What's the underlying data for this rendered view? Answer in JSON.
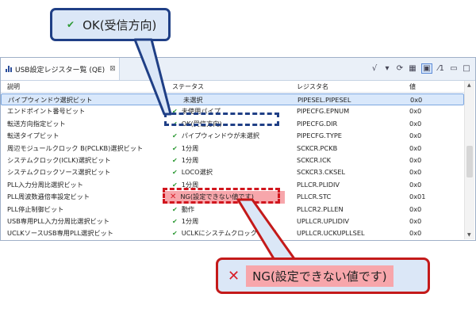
{
  "callouts": {
    "top": {
      "mark": "✔",
      "text": "OK(受信方向)"
    },
    "bottom": {
      "mark": "✕",
      "text": "NG(設定できない値です)"
    }
  },
  "view": {
    "tab_title": "USB設定レジスター覧 (QE)",
    "tab_close": "⊠",
    "toolbar": [
      "√",
      "▾",
      "⟳",
      "▦",
      "▣",
      "⁄1",
      "▭",
      "□"
    ]
  },
  "table": {
    "headers": {
      "desc": "説明",
      "status": "ステータス",
      "reg": "レジスタ名",
      "val": "値"
    },
    "rows": [
      {
        "desc": "パイプウィンドウ選択ビット",
        "mark": "",
        "status": "未選択",
        "reg": "PIPESEL.PIPESEL",
        "val": "0x0",
        "selected": true
      },
      {
        "desc": "エンドポイント番号ビット",
        "mark": "ok",
        "status": "未使用パイプ",
        "reg": "PIPECFG.EPNUM",
        "val": "0x0"
      },
      {
        "desc": "転送方向指定ビット",
        "mark": "ok",
        "status": "OK(受信方向)",
        "reg": "PIPECFG.DIR",
        "val": "0x0"
      },
      {
        "desc": "転送タイプビット",
        "mark": "ok",
        "status": "パイプウィンドウが未選択",
        "reg": "PIPECFG.TYPE",
        "val": "0x0"
      },
      {
        "desc": "周辺モジュールクロック B(PCLKB)選択ビット",
        "mark": "ok",
        "status": "1分周",
        "reg": "SCKCR.PCKB",
        "val": "0x0"
      },
      {
        "desc": "システムクロック(ICLK)選択ビット",
        "mark": "ok",
        "status": "1分周",
        "reg": "SCKCR.ICK",
        "val": "0x0"
      },
      {
        "desc": "システムクロックソース選択ビット",
        "mark": "ok",
        "status": "LOCO選択",
        "reg": "SCKCR3.CKSEL",
        "val": "0x0"
      },
      {
        "desc": "PLL入力分周比選択ビット",
        "mark": "ok",
        "status": "1分周",
        "reg": "PLLCR.PLIDIV",
        "val": "0x0"
      },
      {
        "desc": "PLL周波数逓倍率設定ビット",
        "mark": "ng",
        "status": "NG(設定できない値です)",
        "reg": "PLLCR.STC",
        "val": "0x01"
      },
      {
        "desc": "PLL停止制御ビット",
        "mark": "ok",
        "status": "動作",
        "reg": "PLLCR2.PLLEN",
        "val": "0x0"
      },
      {
        "desc": "USB専用PLL入力分周比選択ビット",
        "mark": "ok",
        "status": "1分周",
        "reg": "UPLLCR.UPLIDIV",
        "val": "0x0"
      },
      {
        "desc": "UCLKソースUSB専用PLL選択ビット",
        "mark": "ok",
        "status": "UCLKにシステムクロックを選択",
        "reg": "UPLLCR.UCKUPLLSEL",
        "val": "0x0"
      }
    ]
  },
  "colors": {
    "ok": "#2e9a35",
    "ng": "#d8202a",
    "accent_blue": "#1f3f86",
    "ng_highlight": "#f7a6ab"
  }
}
